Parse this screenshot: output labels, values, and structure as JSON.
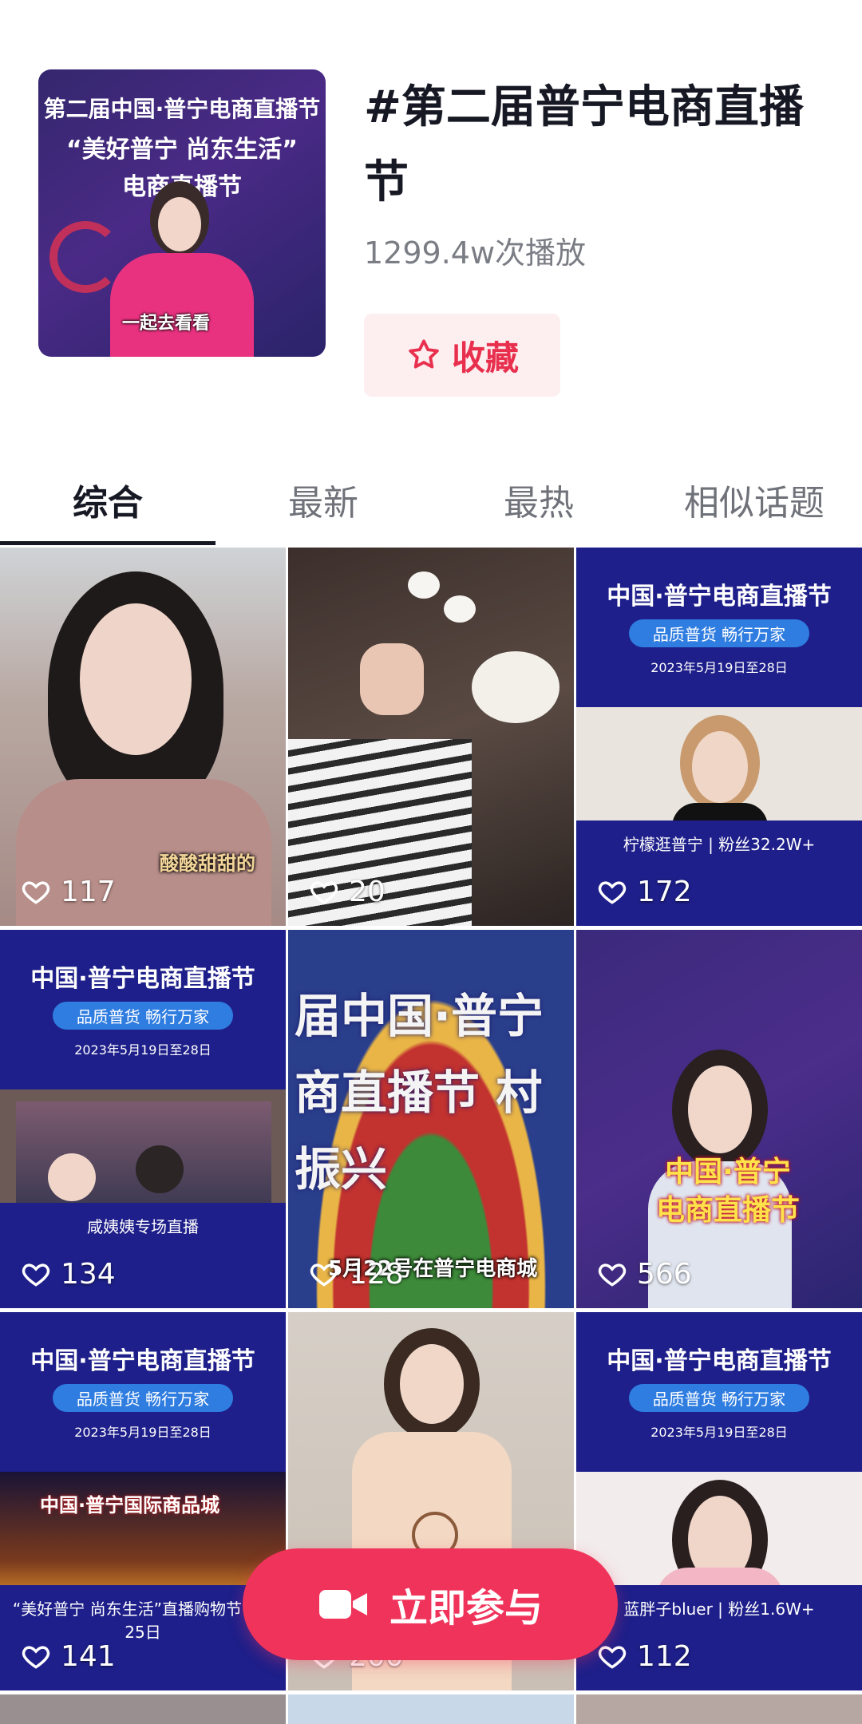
{
  "topic": {
    "title": "#第二届普宁电商直播节",
    "plays": "1299.4w次播放",
    "favorite_label": "收藏",
    "cover": {
      "line1": "第二届中国·普宁电商直播节",
      "line2": "“美好普宁 尚东生活”",
      "line3": "电商直播节",
      "caption": "一起去看看"
    }
  },
  "tabs": [
    {
      "label": "综合",
      "active": true
    },
    {
      "label": "最新",
      "active": false
    },
    {
      "label": "最热",
      "active": false
    },
    {
      "label": "相似话题",
      "active": false
    }
  ],
  "videos": [
    {
      "likes": "117",
      "overlay": "酸酸甜甜的"
    },
    {
      "likes": "20"
    },
    {
      "likes": "172",
      "poster_title": "中国·普宁电商直播节",
      "poster_slogan": "品质普货 畅行万家",
      "poster_date": "2023年5月19日至28日",
      "poster_name": "柠檬逛普宁 | 粉丝32.2W+"
    },
    {
      "likes": "134",
      "poster_title": "中国·普宁电商直播节",
      "poster_slogan": "品质普货 畅行万家",
      "poster_date": "2023年5月19日至28日",
      "poster_name": "咸姨姨专场直播"
    },
    {
      "likes": "128",
      "overlay": "5月22号在普宁电商城",
      "big_text": "届中国·普宁 商直播节 村振兴"
    },
    {
      "likes": "566",
      "big_text": "中国·普宁 电商直播节"
    },
    {
      "likes": "141",
      "poster_title": "中国·普宁电商直播节",
      "poster_slogan": "品质普货 畅行万家",
      "poster_date": "2023年5月19日至28日",
      "poster_name": "“美好普宁 尚东生活”直播购物节 5月25日",
      "sign": "中国·普宁国际商品城"
    },
    {
      "likes": "200"
    },
    {
      "likes": "112",
      "poster_title": "中国·普宁电商直播节",
      "poster_slogan": "品质普货 畅行万家",
      "poster_date": "2023年5月19日至28日",
      "poster_name": "蓝胖子bluer | 粉丝1.6W+"
    }
  ],
  "cta": {
    "label": "立即参与"
  },
  "colors": {
    "accent": "#f0335a",
    "poster_blue": "#1e1f8a"
  }
}
